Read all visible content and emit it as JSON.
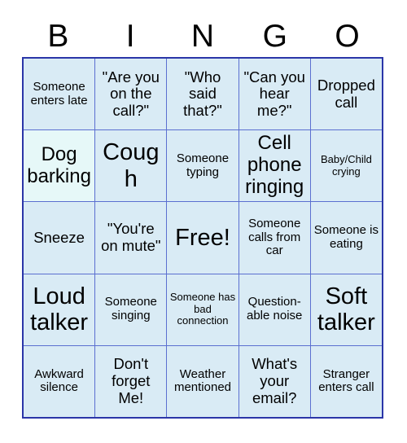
{
  "header": {
    "letters": [
      "B",
      "I",
      "N",
      "G",
      "O"
    ]
  },
  "grid": {
    "columns": 5,
    "rows": 5,
    "colors": {
      "cell_background": "#d9ebf5",
      "cell_background_highlight": "#e6f8f8",
      "grid_line": "#5b6fd0",
      "outer_border": "#2b36a8",
      "text": "#000000",
      "page_background": "#ffffff"
    },
    "cells": [
      {
        "text": "Someone enters late",
        "size": "sm",
        "tint": "normal"
      },
      {
        "text": "\"Are you on the call?\"",
        "size": "md",
        "tint": "normal"
      },
      {
        "text": "\"Who said that?\"",
        "size": "md",
        "tint": "normal"
      },
      {
        "text": "\"Can you hear me?\"",
        "size": "md",
        "tint": "normal"
      },
      {
        "text": "Dropped call",
        "size": "md",
        "tint": "normal"
      },
      {
        "text": "Dog barking",
        "size": "lg",
        "tint": "mint"
      },
      {
        "text": "Cough",
        "size": "xl",
        "tint": "normal"
      },
      {
        "text": "Someone typing",
        "size": "sm",
        "tint": "normal"
      },
      {
        "text": "Cell phone ringing",
        "size": "lg",
        "tint": "normal"
      },
      {
        "text": "Baby/Child crying",
        "size": "xs",
        "tint": "normal"
      },
      {
        "text": "Sneeze",
        "size": "md",
        "tint": "normal"
      },
      {
        "text": "\"You're on mute\"",
        "size": "md",
        "tint": "normal"
      },
      {
        "text": "Free!",
        "size": "xl",
        "tint": "normal"
      },
      {
        "text": "Someone calls from car",
        "size": "sm",
        "tint": "normal"
      },
      {
        "text": "Someone is eating",
        "size": "sm",
        "tint": "normal"
      },
      {
        "text": "Loud talker",
        "size": "xl",
        "tint": "normal"
      },
      {
        "text": "Someone singing",
        "size": "sm",
        "tint": "normal"
      },
      {
        "text": "Someone has bad connection",
        "size": "xs",
        "tint": "normal"
      },
      {
        "text": "Question-able noise",
        "size": "sm",
        "tint": "normal"
      },
      {
        "text": "Soft talker",
        "size": "xl",
        "tint": "normal"
      },
      {
        "text": "Awkward silence",
        "size": "sm",
        "tint": "normal"
      },
      {
        "text": "Don't forget Me!",
        "size": "md",
        "tint": "normal"
      },
      {
        "text": "Weather mentioned",
        "size": "sm",
        "tint": "normal"
      },
      {
        "text": "What's your email?",
        "size": "md",
        "tint": "normal"
      },
      {
        "text": "Stranger enters call",
        "size": "sm",
        "tint": "normal"
      }
    ]
  }
}
